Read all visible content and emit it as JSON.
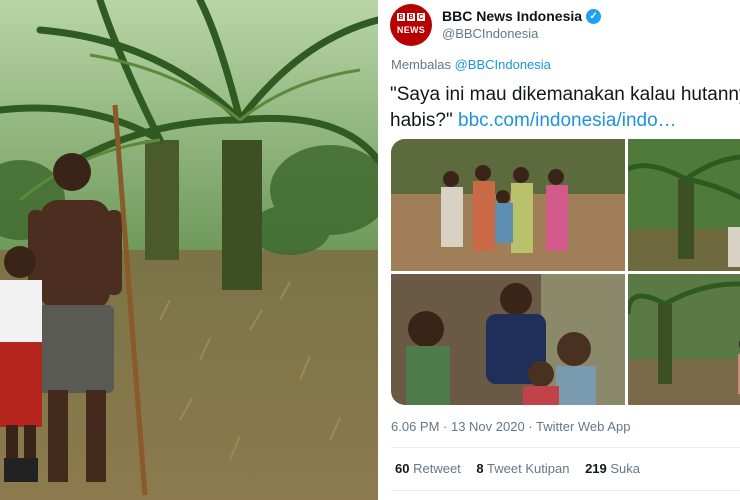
{
  "photo": {
    "alt": "man-and-child-in-palm-plantation"
  },
  "tweet": {
    "display_name": "BBC News Indonesia",
    "handle": "@BBCIndonesia",
    "avatar_top": "BBC",
    "avatar_bottom": "NEWS",
    "reply_prefix": "Membalas",
    "reply_to": "@BBCIndonesia",
    "text": "\"Saya ini mau dikemanakan kalau hutannya habis?\"",
    "text_line1": "\"Saya ini mau dikemanakan kalau hutannya",
    "text_line2": "habis?\"",
    "link": "bbc.com/indonesia/indo…",
    "timestamp": "6.06 PM · 13 Nov 2020 · Twitter Web App",
    "stats": {
      "retweets_count": "60",
      "retweets_label": "Retweet",
      "quotes_count": "8",
      "quotes_label": "Tweet Kutipan",
      "likes_count": "219",
      "likes_label": "Suka"
    }
  },
  "colors": {
    "link_blue": "#1b95e0",
    "verified_blue": "#1da1f2",
    "bbc_red": "#b80000",
    "muted_text": "#657786"
  },
  "icons": [
    "verified-badge-icon"
  ]
}
